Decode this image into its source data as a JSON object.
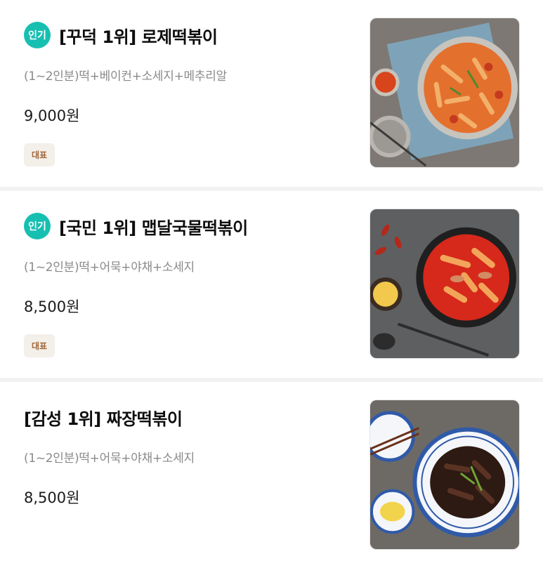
{
  "menu": [
    {
      "popular_badge": "인기",
      "name": "[꾸덕 1위] 로제떡볶이",
      "description": "(1~2인분)떡+베이컨+소세지+메추리알",
      "price": "9,000원",
      "tag": "대표",
      "image": "rose-tteokbokki-photo"
    },
    {
      "popular_badge": "인기",
      "name": "[국민 1위] 맵달국물떡볶이",
      "description": "(1~2인분)떡+어묵+야채+소세지",
      "price": "8,500원",
      "tag": "대표",
      "image": "spicy-soup-tteokbokki-photo"
    },
    {
      "name": "[감성 1위] 짜장떡볶이",
      "description": "(1~2인분)떡+어묵+야채+소세지",
      "price": "8,500원",
      "image": "jjajang-tteokbokki-photo"
    }
  ],
  "colors": {
    "popular_badge": "#17bfb1",
    "tag_bg": "#f3efe9",
    "tag_text": "#a2663a",
    "description": "#8a8a8a",
    "divider": "#f2f2f2"
  }
}
